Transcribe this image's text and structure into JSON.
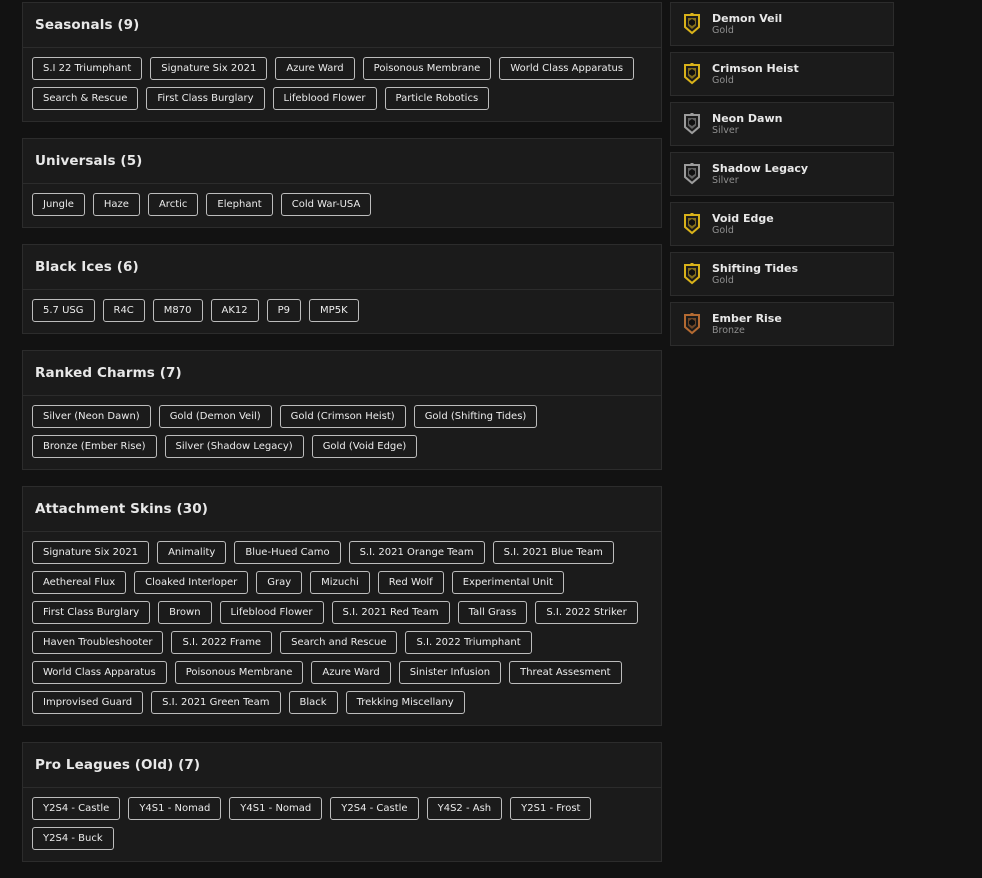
{
  "panels": [
    {
      "title": "Seasonals (9)",
      "chips": [
        "S.I 22 Triumphant",
        "Signature Six 2021",
        "Azure Ward",
        "Poisonous Membrane",
        "World Class Apparatus",
        "Search & Rescue",
        "First Class Burglary",
        "Lifeblood Flower",
        "Particle Robotics"
      ]
    },
    {
      "title": "Universals (5)",
      "chips": [
        "Jungle",
        "Haze",
        "Arctic",
        "Elephant",
        "Cold War-USA"
      ]
    },
    {
      "title": "Black Ices (6)",
      "chips": [
        "5.7 USG",
        "R4C",
        "M870",
        "AK12",
        "P9",
        "MP5K"
      ]
    },
    {
      "title": "Ranked Charms (7)",
      "chips": [
        "Silver (Neon Dawn)",
        "Gold (Demon Veil)",
        "Gold (Crimson Heist)",
        "Gold (Shifting Tides)",
        "Bronze (Ember Rise)",
        "Silver (Shadow Legacy)",
        "Gold (Void Edge)"
      ]
    },
    {
      "title": "Attachment Skins (30)",
      "chips": [
        "Signature Six 2021",
        "Animality",
        "Blue-Hued Camo",
        "S.I. 2021 Orange Team",
        "S.I. 2021 Blue Team",
        "Aethereal Flux",
        "Cloaked Interloper",
        "Gray",
        "Mizuchi",
        "Red Wolf",
        "Experimental Unit",
        "First Class Burglary",
        "Brown",
        "Lifeblood Flower",
        "S.I. 2021 Red Team",
        "Tall Grass",
        "S.I. 2022 Striker",
        "Haven Troubleshooter",
        "S.I. 2022 Frame",
        "Search and Rescue",
        "S.I. 2022 Triumphant",
        "World Class Apparatus",
        "Poisonous Membrane",
        "Azure Ward",
        "Sinister Infusion",
        "Threat Assesment",
        "Improvised Guard",
        "S.I. 2021 Green Team",
        "Black",
        "Trekking Miscellany"
      ]
    },
    {
      "title": "Pro Leagues (Old) (7)",
      "chips": [
        "Y2S4 - Castle",
        "Y4S1 - Nomad",
        "Y4S1 - Nomad",
        "Y2S4 - Castle",
        "Y4S2 - Ash",
        "Y2S1 - Frost",
        "Y2S4 - Buck"
      ]
    }
  ],
  "charms": [
    {
      "name": "Demon Veil",
      "tier": "Gold",
      "color": "#d9b21a"
    },
    {
      "name": "Crimson Heist",
      "tier": "Gold",
      "color": "#d9b21a"
    },
    {
      "name": "Neon Dawn",
      "tier": "Silver",
      "color": "#9c9c9c"
    },
    {
      "name": "Shadow Legacy",
      "tier": "Silver",
      "color": "#9c9c9c"
    },
    {
      "name": "Void Edge",
      "tier": "Gold",
      "color": "#d9b21a"
    },
    {
      "name": "Shifting Tides",
      "tier": "Gold",
      "color": "#d9b21a"
    },
    {
      "name": "Ember Rise",
      "tier": "Bronze",
      "color": "#b36a32"
    }
  ]
}
